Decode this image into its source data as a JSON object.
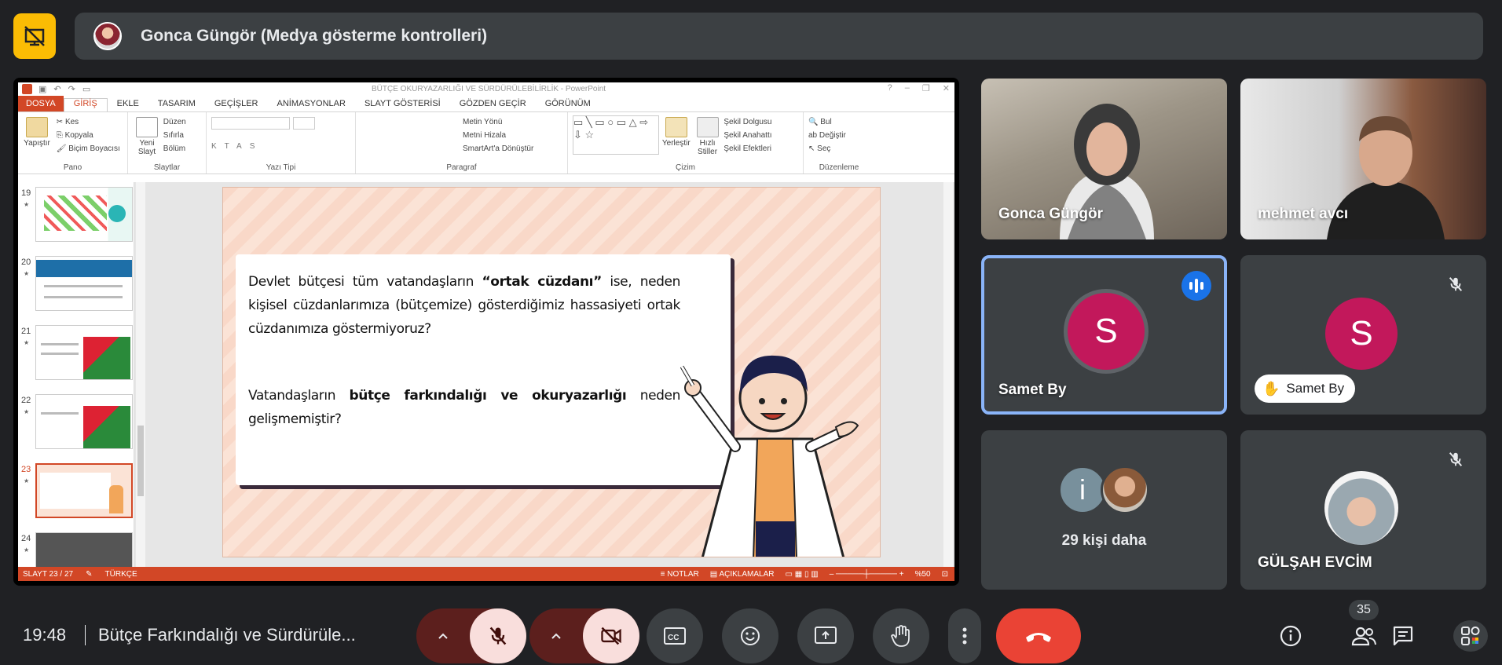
{
  "presenter": {
    "label": "Gonca Güngör (Medya gösterme kontrolleri)"
  },
  "ppt": {
    "window_title": "BÜTÇE OKURYAZARLIĞI VE SÜRDÜRÜLEBİLİRLİK - PowerPoint",
    "tabs": [
      "DOSYA",
      "GİRİŞ",
      "EKLE",
      "TASARIM",
      "GEÇİŞLER",
      "ANİMASYONLAR",
      "SLAYT GÖSTERİSİ",
      "GÖZDEN GEÇİR",
      "GÖRÜNÜM"
    ],
    "ribbon": {
      "clipboard": {
        "paste": "Yapıştır",
        "cut": "Kes",
        "copy": "Kopyala",
        "format_painter": "Biçim Boyacısı",
        "label": "Pano"
      },
      "slides": {
        "new_slide": "Yeni Slayt",
        "layout": "Düzen",
        "reset": "Sıfırla",
        "section": "Bölüm",
        "label": "Slaytlar"
      },
      "font": {
        "label": "Yazı Tipi"
      },
      "paragraph": {
        "text_direction": "Metin Yönü",
        "align_text": "Metni Hizala",
        "smartart": "SmartArt'a Dönüştür",
        "label": "Paragraf"
      },
      "drawing": {
        "arrange": "Yerleştir",
        "quick_styles": "Hızlı Stiller",
        "shape_fill": "Şekil Dolgusu",
        "shape_outline": "Şekil Anahattı",
        "shape_effects": "Şekil Efektleri",
        "label": "Çizim"
      },
      "editing": {
        "find": "Bul",
        "replace": "Değiştir",
        "select": "Seç",
        "label": "Düzenleme"
      }
    },
    "thumbnails": [
      {
        "num": "19",
        "star": "★"
      },
      {
        "num": "20",
        "star": "★"
      },
      {
        "num": "21",
        "star": "★"
      },
      {
        "num": "22",
        "star": "★"
      },
      {
        "num": "23",
        "star": "★"
      },
      {
        "num": "24",
        "star": "★"
      }
    ],
    "slide": {
      "para1_pre": "Devlet bütçesi tüm vatandaşların ",
      "para1_bold": "“ortak cüzdanı”",
      "para1_post": " ise, neden kişisel cüzdanlarımıza (bütçemize) gösterdiğimiz hassasiyeti ortak cüzdanımıza göstermiyoruz?",
      "para2_pre": "Vatandaşların ",
      "para2_bold": "bütçe farkındalığı ve okuryazarlığı",
      "para2_post": " neden gelişmemiştir?"
    },
    "status": {
      "slide_info": "SLAYT 23 / 27",
      "language": "TÜRKÇE",
      "notes": "NOTLAR",
      "comments": "AÇIKLAMALAR",
      "zoom": "%50"
    }
  },
  "participants": [
    {
      "name": "Gonca Güngör"
    },
    {
      "name": "mehmet avcı"
    },
    {
      "name": "Samet By",
      "initial": "S"
    },
    {
      "name": "Samet By",
      "initial": "S"
    },
    {
      "more": "29 kişi daha",
      "initial": "i"
    },
    {
      "name": "GÜLŞAH EVCİM"
    }
  ],
  "bottom": {
    "time": "19:48",
    "meeting_title": "Bütçe Farkındalığı ve Sürdürüle...",
    "people_count": "35"
  },
  "colors": {
    "accent_blue": "#1a73e8",
    "end_call": "#ea4335",
    "present_yellow": "#fbbc04",
    "avatar_pink": "#c2185b",
    "ppt_orange": "#d24726"
  },
  "icons": [
    "stop-presenting-icon",
    "mic-off-icon",
    "camera-off-icon",
    "captions-icon",
    "emoji-icon",
    "present-icon",
    "raise-hand-icon",
    "more-options-icon",
    "end-call-icon",
    "info-icon",
    "people-icon",
    "chat-icon",
    "activities-icon"
  ]
}
